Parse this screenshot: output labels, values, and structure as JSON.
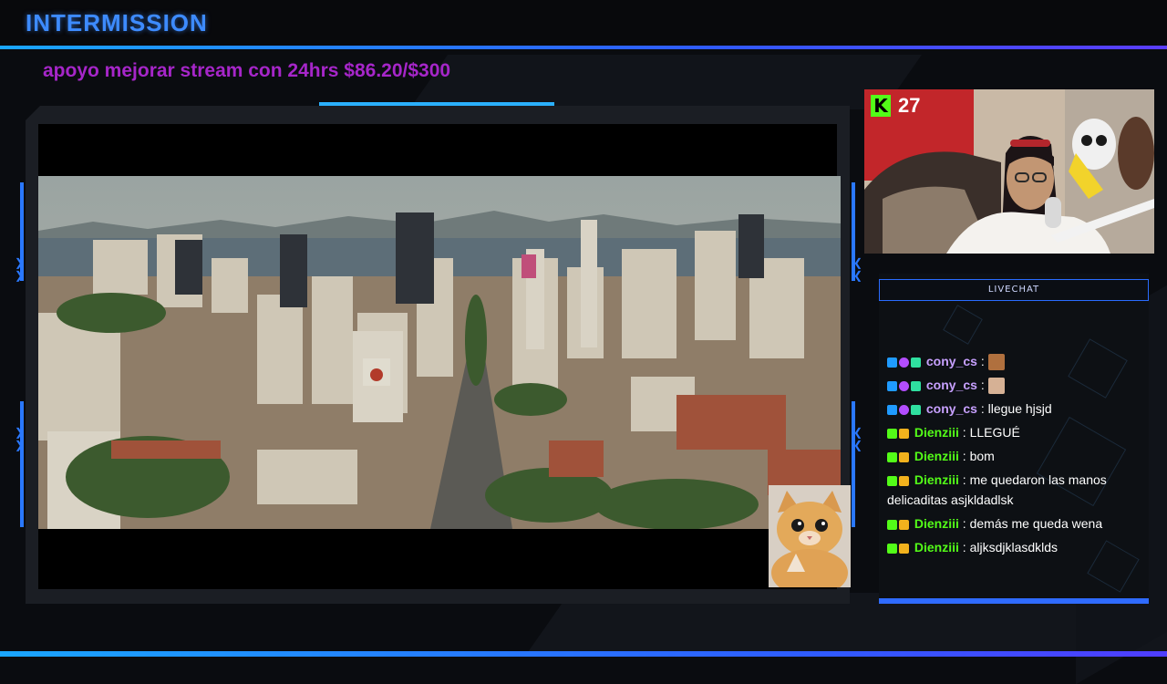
{
  "overlay": {
    "title": "INTERMISSION",
    "goal_text": "apoyo mejorar stream con 24hrs $86.20/$300",
    "viewer_count": "27",
    "chat_header": "LIVECHAT"
  },
  "chat": {
    "messages": [
      {
        "badges": [
          "mod",
          "vip",
          "og"
        ],
        "user": "cony_cs",
        "user_color": "#c7a0ff",
        "text": "",
        "emote": "emote-a"
      },
      {
        "badges": [
          "mod",
          "vip",
          "og"
        ],
        "user": "cony_cs",
        "user_color": "#c7a0ff",
        "text": "",
        "emote": "emote-b"
      },
      {
        "badges": [
          "mod",
          "vip",
          "og"
        ],
        "user": "cony_cs",
        "user_color": "#c7a0ff",
        "text": "llegue hjsjd",
        "emote": ""
      },
      {
        "badges": [
          "sub",
          "crown"
        ],
        "user": "Dienziii",
        "user_color": "#53fc18",
        "text": "LLEGUÉ",
        "emote": ""
      },
      {
        "badges": [
          "sub",
          "crown"
        ],
        "user": "Dienziii",
        "user_color": "#53fc18",
        "text": "bom",
        "emote": ""
      },
      {
        "badges": [
          "sub",
          "crown"
        ],
        "user": "Dienziii",
        "user_color": "#53fc18",
        "text": "me quedaron las manos delicaditas asjkldadlsk",
        "emote": ""
      },
      {
        "badges": [
          "sub",
          "crown"
        ],
        "user": "Dienziii",
        "user_color": "#53fc18",
        "text": "demás me queda wena",
        "emote": ""
      },
      {
        "badges": [
          "sub",
          "crown"
        ],
        "user": "Dienziii",
        "user_color": "#53fc18",
        "text": "aljksdjklasdklds",
        "emote": ""
      }
    ]
  },
  "colors": {
    "accent_blue": "#2a78ff",
    "goal_purple": "#a626c9",
    "kick_green": "#53fc18"
  }
}
